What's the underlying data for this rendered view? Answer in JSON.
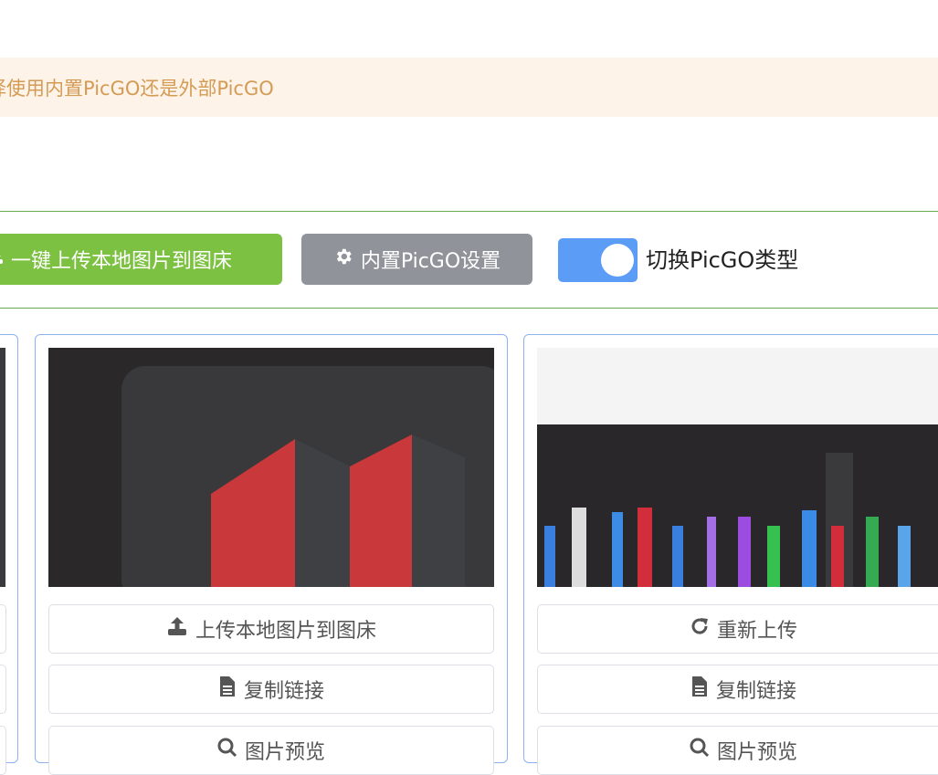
{
  "notice": {
    "text": "择使用内置PicGO还是外部PicGO"
  },
  "toolbar": {
    "upload_all_label": "一键上传本地图片到图床",
    "settings_label": "内置PicGO设置",
    "toggle_label": "切换PicGO类型",
    "toggle_on": true
  },
  "cards": [
    {
      "actions": [
        {
          "icon": "upload-icon",
          "label": "上传本地图片到图床"
        },
        {
          "icon": "file-icon",
          "label": "复制链接"
        },
        {
          "icon": "search-icon",
          "label": "图片预览"
        }
      ]
    },
    {
      "actions": [
        {
          "icon": "redo-icon",
          "label": "重新上传"
        },
        {
          "icon": "file-icon",
          "label": "复制链接"
        },
        {
          "icon": "search-icon",
          "label": "图片预览"
        }
      ]
    }
  ],
  "colors": {
    "accent_green": "#7dc142",
    "settings_gray": "#909399",
    "toggle_blue": "#5b9cf7",
    "notice_text": "#d49b55"
  }
}
